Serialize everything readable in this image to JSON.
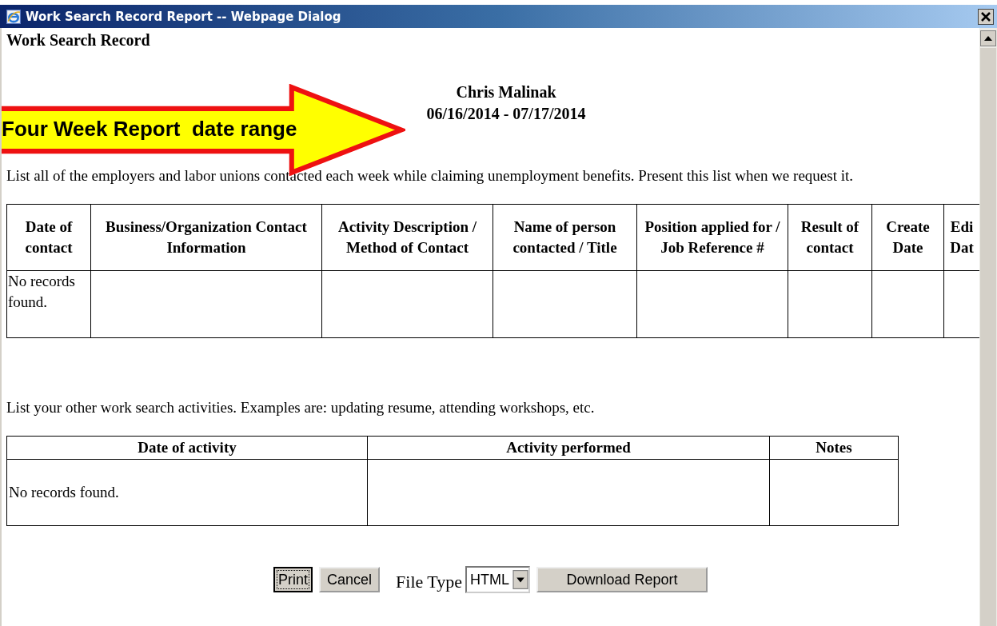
{
  "window": {
    "title": "Work Search Record Report -- Webpage Dialog"
  },
  "heading": "Work Search Record",
  "claimant": {
    "name": "Chris Malinak",
    "date_range": "06/16/2014 - 07/17/2014"
  },
  "callout": {
    "text": "Four Week Report  date range"
  },
  "contacts_intro": "List all of the employers and labor unions contacted each week while claiming unemployment benefits. Present this list when we request it.",
  "contacts_table": {
    "columns": [
      "Date of contact",
      "Business/Organization Contact Information",
      "Activity Description / Method of Contact",
      "Name of person contacted / Title",
      "Position applied for / Job Reference #",
      "Result of contact",
      "Create Date",
      "Edi Dat"
    ],
    "empty_text": "No records found."
  },
  "activities_intro": "List your other work search activities. Examples are: updating resume, attending workshops, etc.",
  "activities_table": {
    "columns": [
      "Date of activity",
      "Activity performed",
      "Notes"
    ],
    "empty_text": "No records found."
  },
  "buttons": [
    {
      "label": "Print",
      "focused": true
    },
    {
      "label": "Cancel",
      "focused": false
    }
  ],
  "file_type": {
    "label": "File Type",
    "value": "HTML"
  },
  "download_button": {
    "label": "Download Report"
  }
}
